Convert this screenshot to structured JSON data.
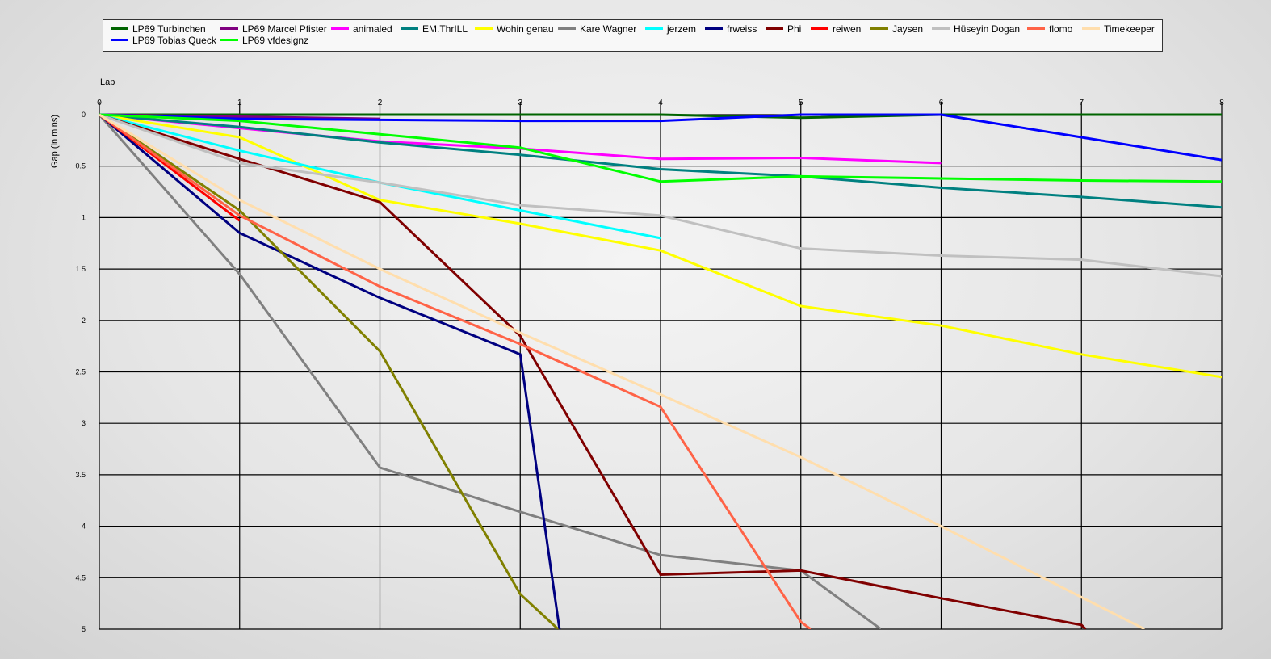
{
  "chart_data": {
    "type": "line",
    "xlabel": "Lap",
    "ylabel": "Gap (in mins)",
    "xlim": [
      0,
      8
    ],
    "ylim": [
      0,
      5
    ],
    "y_inverted": true,
    "grid": true,
    "legend_position": "top",
    "x_ticks": [
      "0",
      "1",
      "2",
      "3",
      "4",
      "5",
      "6",
      "7",
      "8"
    ],
    "y_ticks": [
      {
        "v": 0,
        "label": "0"
      },
      {
        "v": 0.5,
        "label": "0.5"
      },
      {
        "v": 1,
        "label": "1"
      },
      {
        "v": 1.5,
        "label": "1.5"
      },
      {
        "v": 2,
        "label": "2"
      },
      {
        "v": 2.5,
        "label": "2.5"
      },
      {
        "v": 3,
        "label": "3"
      },
      {
        "v": 3.5,
        "label": "3.5"
      },
      {
        "v": 4,
        "label": "4"
      },
      {
        "v": 4.5,
        "label": "4.5"
      },
      {
        "v": 5,
        "label": "5"
      }
    ],
    "series": [
      {
        "name": "LP69 Turbinchen",
        "color": "#006400",
        "x": [
          0,
          1,
          2,
          3,
          4,
          5,
          6,
          7,
          8
        ],
        "y": [
          0,
          0,
          0,
          0,
          0,
          0.03,
          0,
          0,
          0
        ]
      },
      {
        "name": "LP69 Marcel Pfister",
        "color": "#800080",
        "x": [
          0,
          1,
          2
        ],
        "y": [
          0,
          0.02,
          0.04
        ]
      },
      {
        "name": "animaled",
        "color": "#ff00ff",
        "x": [
          0,
          1,
          2,
          3,
          4,
          5,
          6
        ],
        "y": [
          0,
          0.13,
          0.26,
          0.33,
          0.43,
          0.42,
          0.47
        ]
      },
      {
        "name": "EM.ThrILL",
        "color": "#008080",
        "x": [
          0,
          1,
          2,
          3,
          4,
          5,
          6,
          7,
          8
        ],
        "y": [
          0,
          0.12,
          0.27,
          0.39,
          0.53,
          0.6,
          0.71,
          0.8,
          0.9
        ]
      },
      {
        "name": "Wohin genau",
        "color": "#ffff00",
        "x": [
          0,
          1,
          2,
          3,
          4,
          5,
          6,
          7,
          8
        ],
        "y": [
          0,
          0.22,
          0.83,
          1.06,
          1.32,
          1.86,
          2.05,
          2.33,
          2.55
        ]
      },
      {
        "name": "Kare Wagner",
        "color": "#808080",
        "x": [
          0,
          1,
          2,
          3,
          4,
          5,
          5.57
        ],
        "y": [
          0,
          1.55,
          3.43,
          3.86,
          4.28,
          4.43,
          5
        ]
      },
      {
        "name": "jerzem",
        "color": "#00ffff",
        "x": [
          0,
          1,
          2,
          3,
          4
        ],
        "y": [
          0,
          0.35,
          0.66,
          0.93,
          1.2
        ]
      },
      {
        "name": "frweiss",
        "color": "#000080",
        "x": [
          0,
          1,
          2,
          3,
          3.28
        ],
        "y": [
          0,
          1.15,
          1.78,
          2.33,
          5
        ]
      },
      {
        "name": "Phi",
        "color": "#800000",
        "x": [
          0,
          1,
          2,
          3,
          4,
          5,
          6,
          7,
          7.03
        ],
        "y": [
          0,
          0.43,
          0.85,
          2.15,
          4.47,
          4.43,
          4.7,
          4.96,
          5
        ]
      },
      {
        "name": "reiwen",
        "color": "#ff0000",
        "x": [
          0,
          1
        ],
        "y": [
          0,
          1.03
        ]
      },
      {
        "name": "Jaysen",
        "color": "#808000",
        "x": [
          0,
          1,
          2,
          3,
          3.27
        ],
        "y": [
          0,
          0.93,
          2.3,
          4.66,
          5
        ]
      },
      {
        "name": "Hüseyin  Dogan",
        "color": "#c0c0c0",
        "x": [
          0,
          1,
          2,
          3,
          4,
          5,
          6,
          7,
          8
        ],
        "y": [
          0,
          0.47,
          0.66,
          0.88,
          0.98,
          1.3,
          1.37,
          1.41,
          1.57
        ]
      },
      {
        "name": "LP69 Tobias Queck",
        "color": "#0000ff",
        "x": [
          0,
          1,
          2,
          3,
          4,
          5,
          6,
          7,
          8
        ],
        "y": [
          0,
          0.04,
          0.05,
          0.06,
          0.06,
          0,
          0,
          0.22,
          0.44
        ]
      },
      {
        "name": "LP69 vfdesignz",
        "color": "#00ff00",
        "x": [
          0,
          1,
          2,
          3,
          4,
          5,
          6,
          7,
          8
        ],
        "y": [
          0,
          0.06,
          0.19,
          0.32,
          0.65,
          0.6,
          0.62,
          0.64,
          0.65
        ]
      },
      {
        "name": "flomo",
        "color": "#ff6347",
        "x": [
          0,
          1,
          2,
          3,
          4,
          5,
          5.07
        ],
        "y": [
          0,
          0.98,
          1.67,
          2.23,
          2.84,
          4.93,
          5
        ]
      },
      {
        "name": "Timekeeper",
        "color": "#ffdead",
        "x": [
          0,
          1,
          2,
          3,
          4,
          5,
          6,
          7,
          7.45
        ],
        "y": [
          0,
          0.83,
          1.5,
          2.12,
          2.72,
          3.33,
          4.0,
          4.69,
          5
        ]
      }
    ]
  }
}
